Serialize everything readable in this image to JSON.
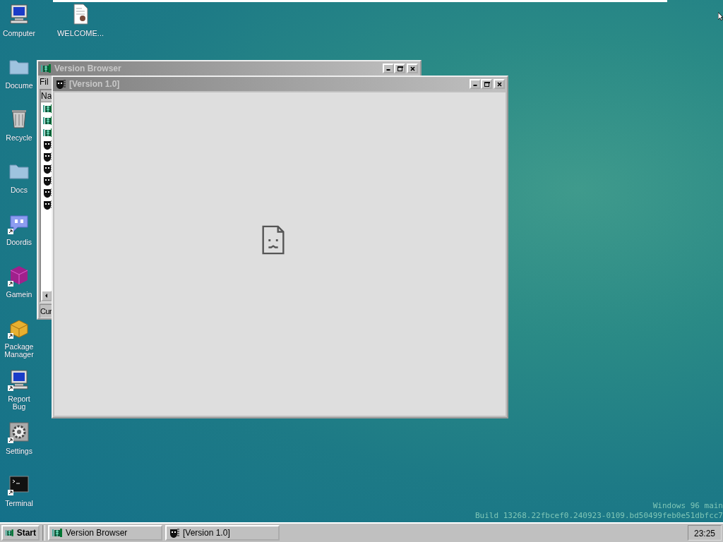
{
  "desktop": {
    "columns": [
      [
        {
          "label": "Computer",
          "kind": "computer",
          "shortcut": false
        },
        {
          "label": "Docume",
          "kind": "folder",
          "shortcut": false
        },
        {
          "label": "Recycle",
          "kind": "bin",
          "shortcut": false
        },
        {
          "label": "Docs",
          "kind": "folder",
          "shortcut": false
        },
        {
          "label": "Doordis",
          "kind": "chat",
          "shortcut": true
        },
        {
          "label": "Gamein",
          "kind": "cube",
          "shortcut": true
        },
        {
          "label": "Package Manager",
          "kind": "box",
          "shortcut": true
        },
        {
          "label": "Report Bug",
          "kind": "computer",
          "shortcut": true
        },
        {
          "label": "Settings",
          "kind": "gear",
          "shortcut": true
        },
        {
          "label": "Terminal",
          "kind": "terminal",
          "shortcut": true
        }
      ],
      [
        {
          "label": "WELCOME...",
          "kind": "document",
          "shortcut": false
        }
      ]
    ],
    "build_info": [
      "Windows 96 main",
      "Build 13268.22fbcef0.240923-0109.bd50499feb0e51dbfcc7"
    ]
  },
  "windows": [
    {
      "title": "Version Browser",
      "kind": "tree",
      "active": false,
      "menu": [
        "Fil"
      ],
      "list_header": "Na",
      "list_rows": [
        {
          "kind": "tree"
        },
        {
          "kind": "tree"
        },
        {
          "kind": "tree"
        },
        {
          "kind": "mask"
        },
        {
          "kind": "mask"
        },
        {
          "kind": "mask"
        },
        {
          "kind": "mask"
        },
        {
          "kind": "mask"
        },
        {
          "kind": "mask"
        }
      ],
      "status_bar": "Cur"
    },
    {
      "title": "[Version 1.0]",
      "kind": "mask",
      "active": false
    }
  ],
  "taskbar": {
    "start": "Start",
    "tasks": [
      {
        "label": "Version Browser",
        "kind": "tree",
        "selected": false
      },
      {
        "label": "[Version 1.0]",
        "kind": "mask",
        "selected": false
      }
    ],
    "clock": "23:25"
  }
}
